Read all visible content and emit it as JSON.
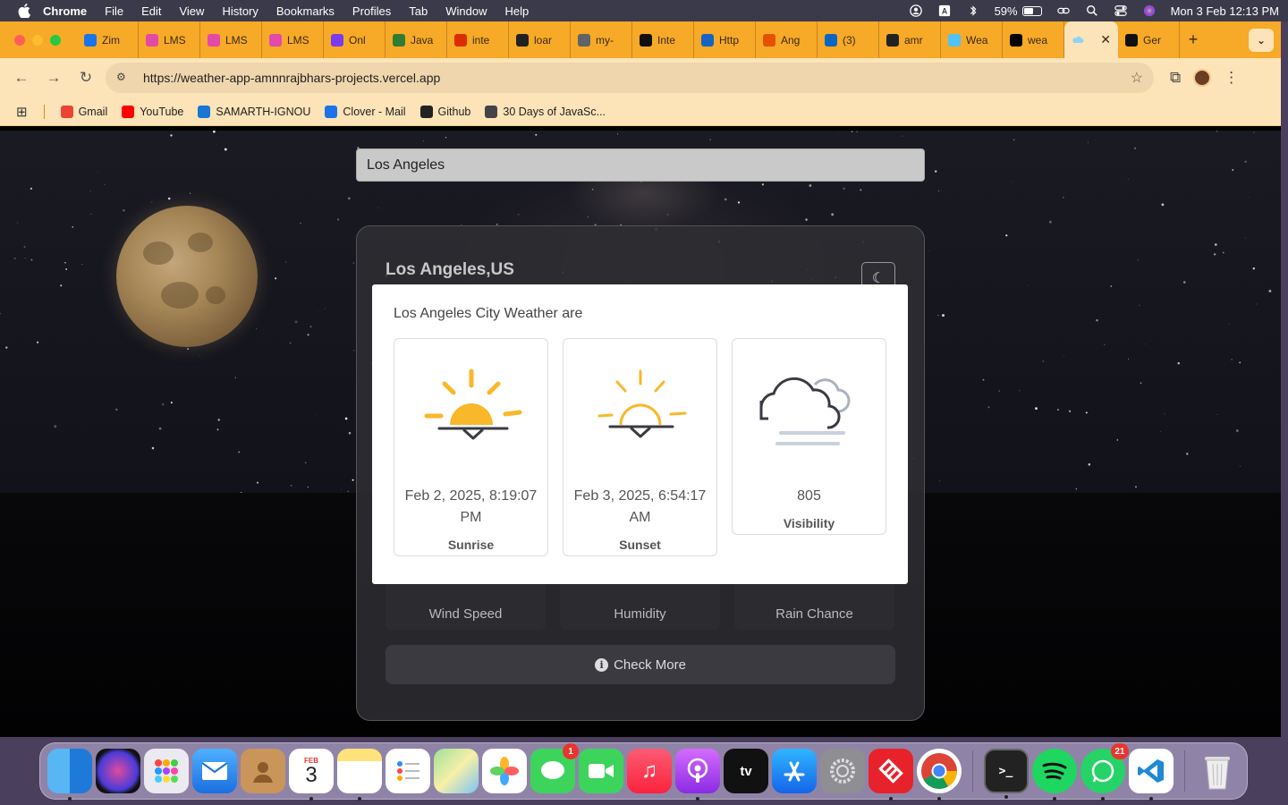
{
  "menubar": {
    "app": "Chrome",
    "items": [
      "File",
      "Edit",
      "View",
      "History",
      "Bookmarks",
      "Profiles",
      "Tab",
      "Window",
      "Help"
    ],
    "battery": "59%",
    "battery_level": 0.59,
    "clock": "Mon 3 Feb  12:13 PM"
  },
  "tabs": [
    {
      "title": "Zim",
      "color": "#1a73e8"
    },
    {
      "title": "LMS",
      "color": "#e24aa8"
    },
    {
      "title": "LMS",
      "color": "#e24aa8"
    },
    {
      "title": "LMS",
      "color": "#e24aa8"
    },
    {
      "title": "Onl",
      "color": "#7c3aed"
    },
    {
      "title": "Java",
      "color": "#2e7d32"
    },
    {
      "title": "inte",
      "color": "#dd2c00"
    },
    {
      "title": "loar",
      "color": "#222222"
    },
    {
      "title": "my-",
      "color": "#5f6368"
    },
    {
      "title": "Inte",
      "color": "#111111"
    },
    {
      "title": "Http",
      "color": "#1565c0"
    },
    {
      "title": "Ang",
      "color": "#e65100"
    },
    {
      "title": "(3)",
      "color": "#0a66c2"
    },
    {
      "title": "amr",
      "color": "#222222"
    },
    {
      "title": "Wea",
      "color": "#4fc3f7"
    },
    {
      "title": "wea",
      "color": "#000000"
    }
  ],
  "active_tab": {
    "title": "",
    "color": "#4fc3f7"
  },
  "last_tab": {
    "title": "Ger",
    "color": "#111111"
  },
  "url": "https://weather-app-amnnrajbhars-projects.vercel.app",
  "bookmarks": [
    {
      "label": "Gmail",
      "color": "#ea4335"
    },
    {
      "label": "YouTube",
      "color": "#ff0000"
    },
    {
      "label": "SAMARTH-IGNOU",
      "color": "#1976d2"
    },
    {
      "label": "Clover - Mail",
      "color": "#1a73e8"
    },
    {
      "label": "Github",
      "color": "#222222"
    },
    {
      "label": "30 Days of JavaSc...",
      "color": "#444444"
    }
  ],
  "app": {
    "search_value": "Los Angeles",
    "city": "Los Angeles,US",
    "tiles": [
      "Wind Speed",
      "Humidity",
      "Rain Chance"
    ],
    "check_more": "Check More"
  },
  "modal": {
    "title": "Los Angeles City Weather are",
    "cards": [
      {
        "value": "Feb 2, 2025, 8:19:07 PM",
        "label": "Sunrise",
        "icon": "sunrise-icon"
      },
      {
        "value": "Feb 3, 2025, 6:54:17 AM",
        "label": "Sunset",
        "icon": "sunset-icon"
      },
      {
        "value": "805",
        "label": "Visibility",
        "icon": "fog-cloud-icon"
      }
    ]
  },
  "dock": {
    "calendar_month": "FEB",
    "calendar_day": "3",
    "messages_badge": "1",
    "whatsapp_badge": "21",
    "tv_label": "tv"
  },
  "colors": {
    "sun": "#f9b72a",
    "tab_strip": "#f7a928",
    "toolbar": "#fde3b8"
  }
}
